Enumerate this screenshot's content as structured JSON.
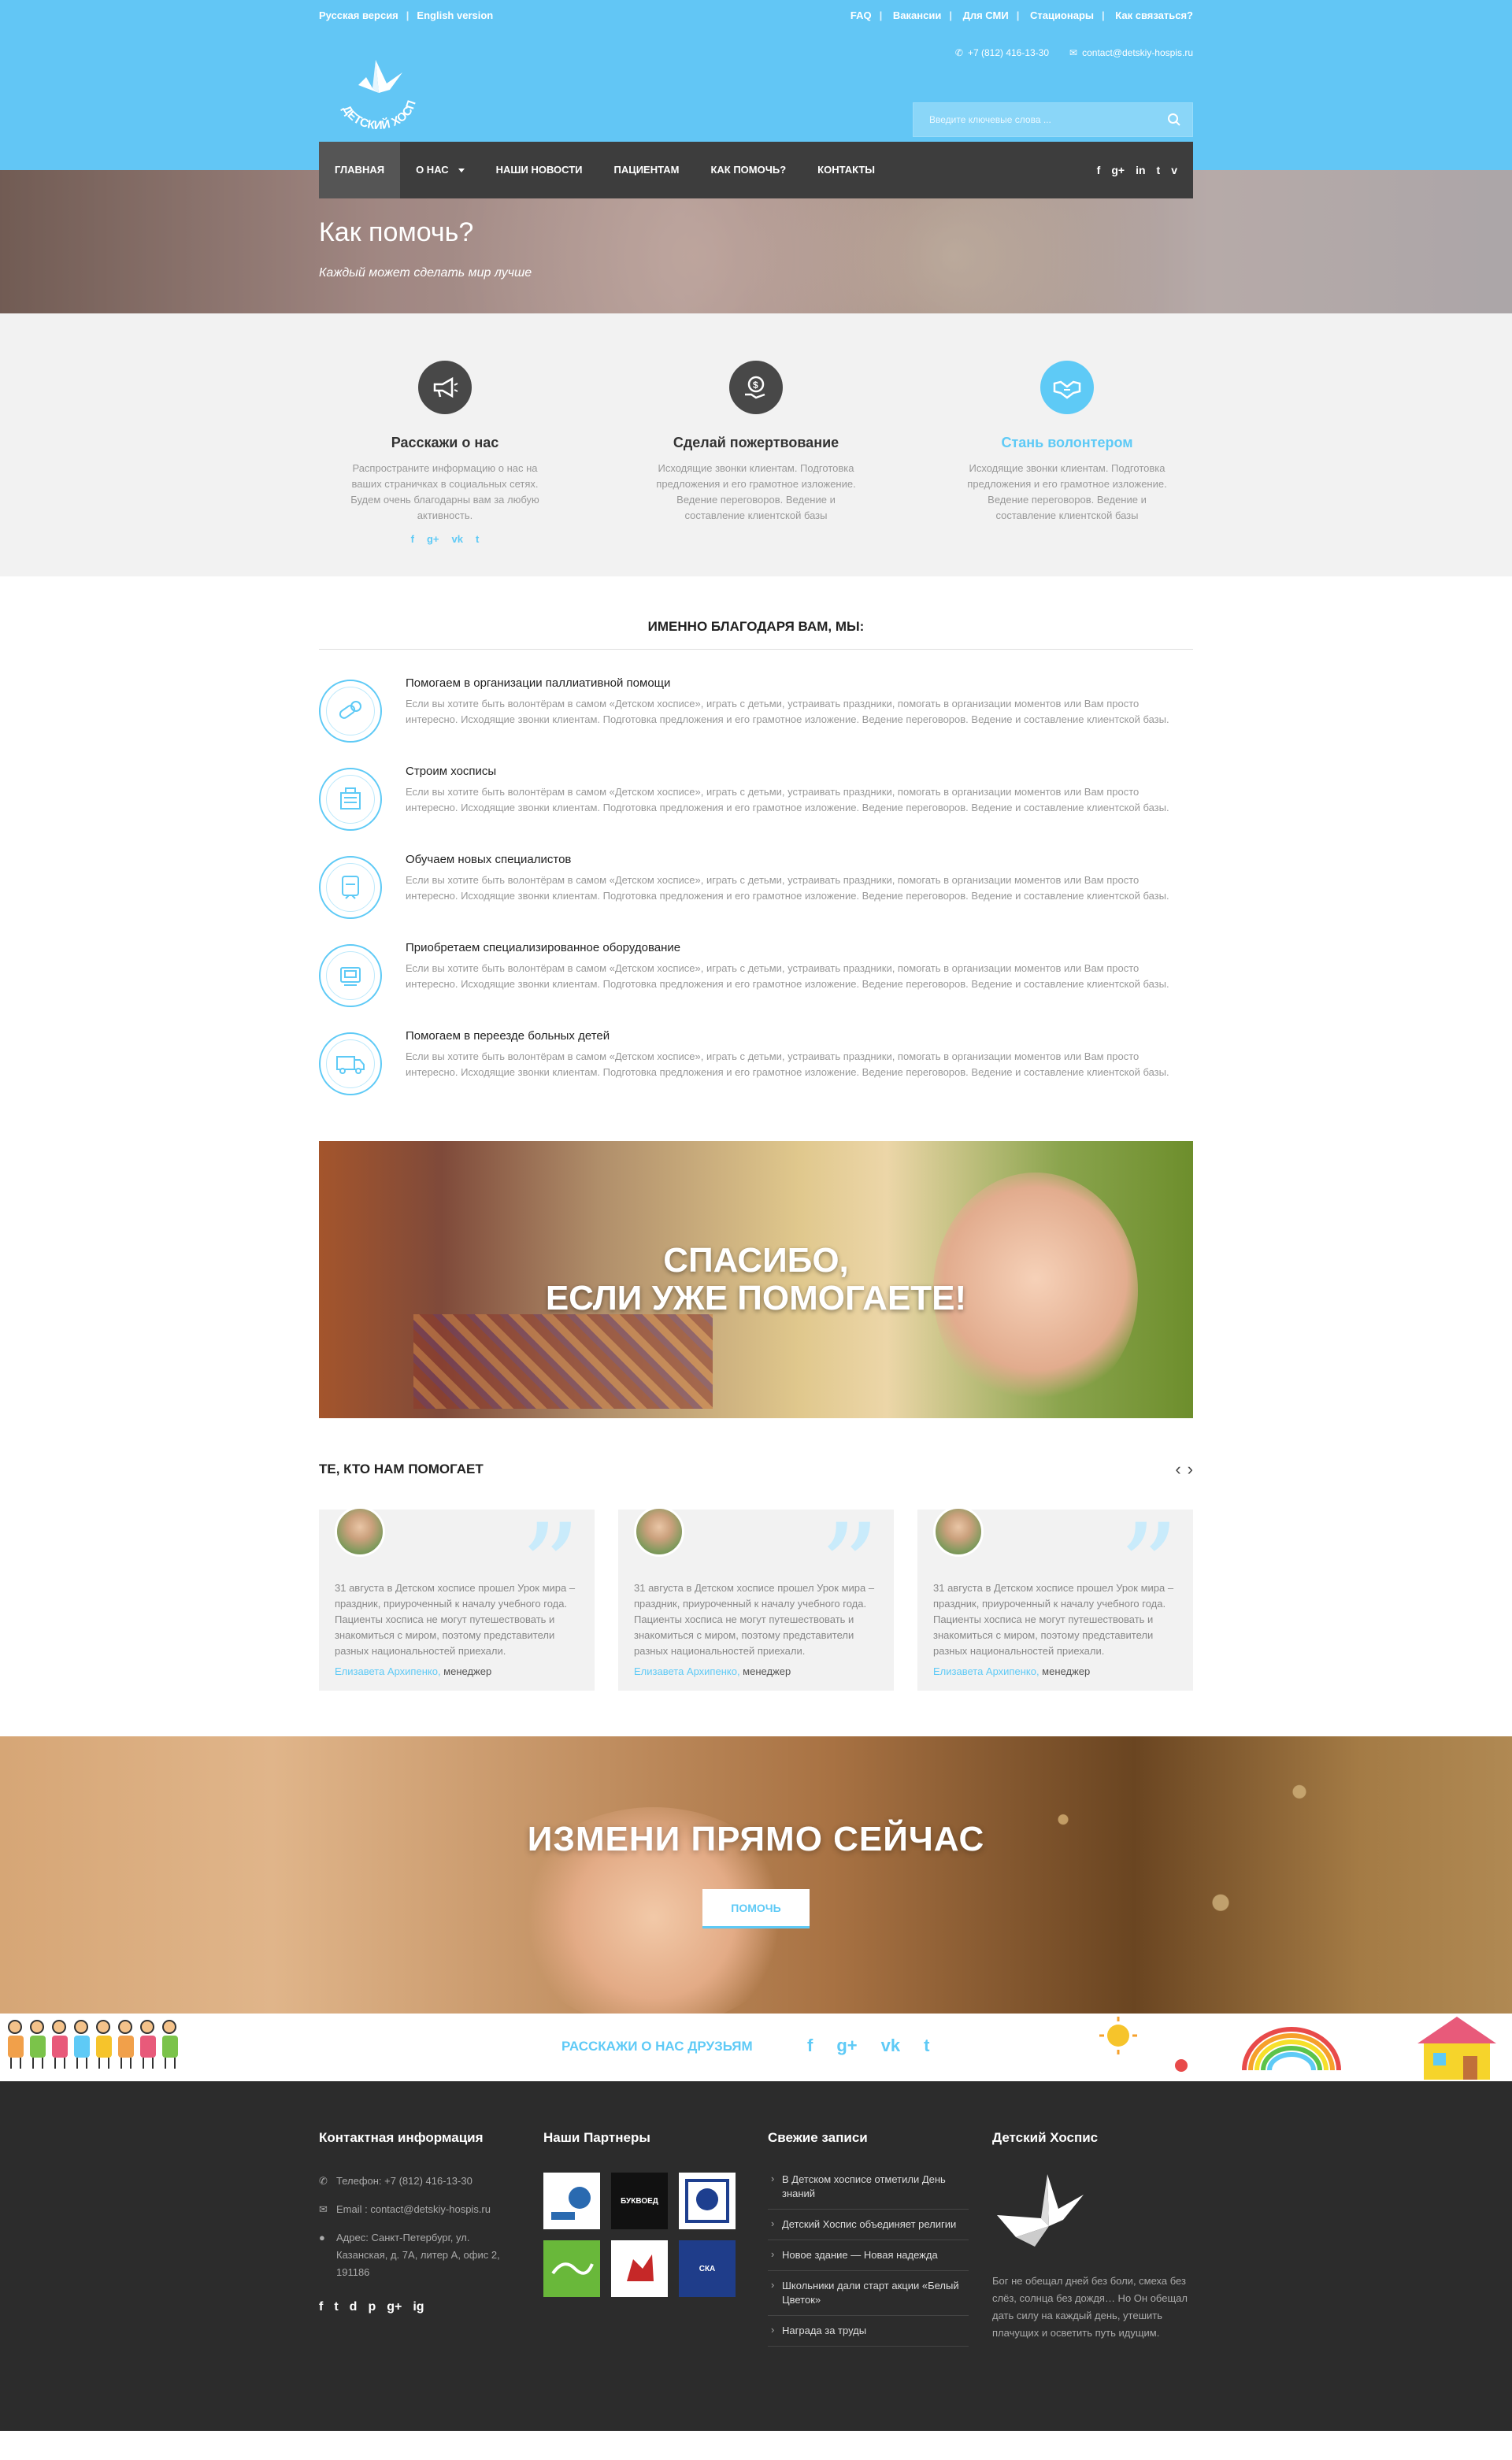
{
  "topbar": {
    "lang_ru": "Русская версия",
    "lang_en": "English version",
    "links": [
      "FAQ",
      "Вакансии",
      "Для СМИ",
      "Стационары",
      "Как связаться?"
    ]
  },
  "header": {
    "logo_text": "ДЕТСКИЙ ХОСПИС",
    "phone": "+7 (812) 416-13-30",
    "email": "contact@detskiy-hospis.ru",
    "search_placeholder": "Введите ключевые слова ..."
  },
  "nav": {
    "items": [
      "ГЛАВНАЯ",
      "О НАС",
      "НАШИ НОВОСТИ",
      "ПАЦИЕНТАМ",
      "КАК ПОМОЧЬ?",
      "КОНТАКТЫ"
    ],
    "social": [
      "f",
      "g+",
      "in",
      "t",
      "v"
    ]
  },
  "hero": {
    "title": "Как помочь?",
    "subtitle": "Каждый может сделать мир лучше"
  },
  "help_options": [
    {
      "title": "Расскажи о нас",
      "text": "Распространите информацию о нас на ваших страничках в социальных сетях. Будем очень благодарны вам за любую активность.",
      "icon": "megaphone-icon"
    },
    {
      "title": "Сделай пожертвование",
      "text": "Исходящие звонки клиентам. Подготовка предложения и его грамотное изложение. Ведение переговоров. Ведение и составление клиентской базы",
      "icon": "donation-icon"
    },
    {
      "title": "Стань волонтером",
      "text": "Исходящие звонки клиентам. Подготовка предложения и его грамотное изложение. Ведение переговоров. Ведение и составление клиентской базы",
      "icon": "handshake-icon"
    }
  ],
  "help_social": [
    "f",
    "g+",
    "vk",
    "t"
  ],
  "intro": {
    "title": "ИМЕННО БЛАГОДАРЯ ВАМ, МЫ:",
    "features": [
      {
        "title": "Помогаем в организации паллиативной помощи",
        "text": "Если вы хотите быть волонтёрам в самом «Детском хосписе», играть с детьми, устраивать праздники, помогать в организации моментов или Вам просто интересно. Исходящие звонки клиентам. Подготовка предложения и его грамотное изложение. Ведение переговоров. Ведение и составление клиентской базы.",
        "icon": "pills-icon"
      },
      {
        "title": "Строим хосписы",
        "text": "Если вы хотите быть волонтёрам в самом «Детском хосписе», играть с детьми, устраивать праздники, помогать в организации моментов или Вам просто интересно. Исходящие звонки клиентам. Подготовка предложения и его грамотное изложение. Ведение переговоров. Ведение и составление клиентской базы.",
        "icon": "building-icon"
      },
      {
        "title": "Обучаем новых специалистов",
        "text": "Если вы хотите быть волонтёрам в самом «Детском хосписе», играть с детьми, устраивать праздники, помогать в организации моментов или Вам просто интересно. Исходящие звонки клиентам. Подготовка предложения и его грамотное изложение. Ведение переговоров. Ведение и составление клиентской базы.",
        "icon": "specialist-icon"
      },
      {
        "title": "Приобретаем специализированное оборудование",
        "text": "Если вы хотите быть волонтёрам в самом «Детском хосписе», играть с детьми, устраивать праздники, помогать в организации моментов или Вам просто интересно. Исходящие звонки клиентам. Подготовка предложения и его грамотное изложение. Ведение переговоров. Ведение и составление клиентской базы.",
        "icon": "equipment-icon"
      },
      {
        "title": "Помогаем в переезде больных детей",
        "text": "Если вы хотите быть волонтёрам в самом «Детском хосписе», играть с детьми, устраивать праздники, помогать в организации моментов или Вам просто интересно. Исходящие звонки клиентам. Подготовка предложения и его грамотное изложение. Ведение переговоров. Ведение и составление клиентской базы.",
        "icon": "truck-icon"
      }
    ]
  },
  "thanks_banner": {
    "line1": "СПАСИБО,",
    "line2": "ЕСЛИ УЖЕ ПОМОГАЕТЕ!"
  },
  "helpers": {
    "title": "ТЕ, КТО НАМ ПОМОГАЕТ",
    "cards": [
      {
        "text": "31 августа в Детском хосписе прошел Урок мира – праздник, приуроченный к началу учебного года. Пациенты хосписа не могут путешествовать и знакомиться с миром, поэтому представители разных национальностей приехали.",
        "name": "Елизавета Архипенко,",
        "role": " менеджер"
      },
      {
        "text": "31 августа в Детском хосписе прошел Урок мира – праздник, приуроченный к началу учебного года. Пациенты хосписа не могут путешествовать и знакомиться с миром, поэтому представители разных национальностей приехали.",
        "name": "Елизавета Архипенко,",
        "role": " менеджер"
      },
      {
        "text": "31 августа в Детском хосписе прошел Урок мира – праздник, приуроченный к началу учебного года. Пациенты хосписа не могут путешествовать и знакомиться с миром, поэтому представители разных национальностей приехали.",
        "name": "Елизавета Архипенко,",
        "role": " менеджер"
      }
    ]
  },
  "change_banner": {
    "title": "ИЗМЕНИ ПРЯМО СЕЙЧАС",
    "button": "ПОМОЧЬ"
  },
  "share": {
    "text": "РАССКАЖИ О НАС ДРУЗЬЯМ",
    "icons": [
      "f",
      "g+",
      "vk",
      "t"
    ]
  },
  "footer": {
    "contact_title": "Контактная информация",
    "phone": "Телефон: +7 (812) 416-13-30",
    "email": "Email : contact@detskiy-hospis.ru",
    "address": "Адрес: Санкт-Петербург, ул. Казанская, д. 7А, литер А, офис 2, 191186",
    "social": [
      "f",
      "t",
      "d",
      "p",
      "g+",
      "ig"
    ],
    "partners_title": "Наши Партнеры",
    "partners": [
      "",
      "БУКВОЕД",
      "",
      "",
      "",
      "СКА"
    ],
    "posts_title": "Свежие записи",
    "posts": [
      "В Детском хосписе отметили День знаний",
      "Детский Хоспис объединяет религии",
      "Новое здание — Новая надежда",
      "Школьники дали старт акции «Белый Цветок»",
      "Награда за труды"
    ],
    "hospis_title": "Детский Хоспис",
    "hospis_text": "Бог не обещал дней без боли, смеха без слёз, солнца без дождя… Но Он обещал дать силу на каждый день, утешить плачущих и осветить путь идущим."
  },
  "colors": {
    "accent": "#5ecaf6",
    "header": "#62c6f5",
    "nav": "#3d3d3d",
    "footer": "#2c2c2c"
  }
}
